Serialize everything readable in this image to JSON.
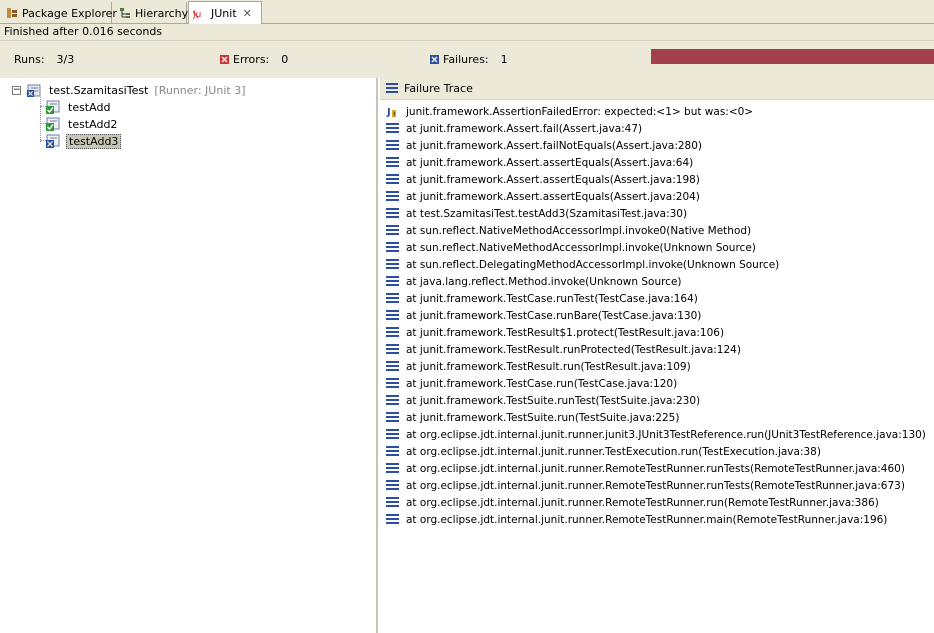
{
  "tabs": [
    {
      "label": "Package Explorer",
      "icon": "package-explorer-icon"
    },
    {
      "label": "Hierarchy",
      "icon": "hierarchy-icon"
    },
    {
      "label": "JUnit",
      "icon": "junit-icon",
      "active": true
    }
  ],
  "status": "Finished after 0.016 seconds",
  "counters": {
    "runs_label": "Runs:",
    "runs_value": "3/3",
    "errors_label": "Errors:",
    "errors_value": "0",
    "failures_label": "Failures:",
    "failures_value": "1",
    "progress_fraction": 1.0,
    "progress_color": "#a3404b"
  },
  "tree": {
    "root_label": "test.SzamitasiTest",
    "root_runner": "[Runner: JUnit 3]",
    "children": [
      {
        "label": "testAdd",
        "status": "passed"
      },
      {
        "label": "testAdd2",
        "status": "passed"
      },
      {
        "label": "testAdd3",
        "status": "failed",
        "selected": true
      }
    ]
  },
  "trace": {
    "header": "Failure Trace",
    "lines": [
      "junit.framework.AssertionFailedError: expected:<1> but was:<0>",
      "at junit.framework.Assert.fail(Assert.java:47)",
      "at junit.framework.Assert.failNotEquals(Assert.java:280)",
      "at junit.framework.Assert.assertEquals(Assert.java:64)",
      "at junit.framework.Assert.assertEquals(Assert.java:198)",
      "at junit.framework.Assert.assertEquals(Assert.java:204)",
      "at test.SzamitasiTest.testAdd3(SzamitasiTest.java:30)",
      "at sun.reflect.NativeMethodAccessorImpl.invoke0(Native Method)",
      "at sun.reflect.NativeMethodAccessorImpl.invoke(Unknown Source)",
      "at sun.reflect.DelegatingMethodAccessorImpl.invoke(Unknown Source)",
      "at java.lang.reflect.Method.invoke(Unknown Source)",
      "at junit.framework.TestCase.runTest(TestCase.java:164)",
      "at junit.framework.TestCase.runBare(TestCase.java:130)",
      "at junit.framework.TestResult$1.protect(TestResult.java:106)",
      "at junit.framework.TestResult.runProtected(TestResult.java:124)",
      "at junit.framework.TestResult.run(TestResult.java:109)",
      "at junit.framework.TestCase.run(TestCase.java:120)",
      "at junit.framework.TestSuite.runTest(TestSuite.java:230)",
      "at junit.framework.TestSuite.run(TestSuite.java:225)",
      "at org.eclipse.jdt.internal.junit.runner.junit3.JUnit3TestReference.run(JUnit3TestReference.java:130)",
      "at org.eclipse.jdt.internal.junit.runner.TestExecution.run(TestExecution.java:38)",
      "at org.eclipse.jdt.internal.junit.runner.RemoteTestRunner.runTests(RemoteTestRunner.java:460)",
      "at org.eclipse.jdt.internal.junit.runner.RemoteTestRunner.runTests(RemoteTestRunner.java:673)",
      "at org.eclipse.jdt.internal.junit.runner.RemoteTestRunner.run(RemoteTestRunner.java:386)",
      "at org.eclipse.jdt.internal.junit.runner.RemoteTestRunner.main(RemoteTestRunner.java:196)"
    ]
  }
}
